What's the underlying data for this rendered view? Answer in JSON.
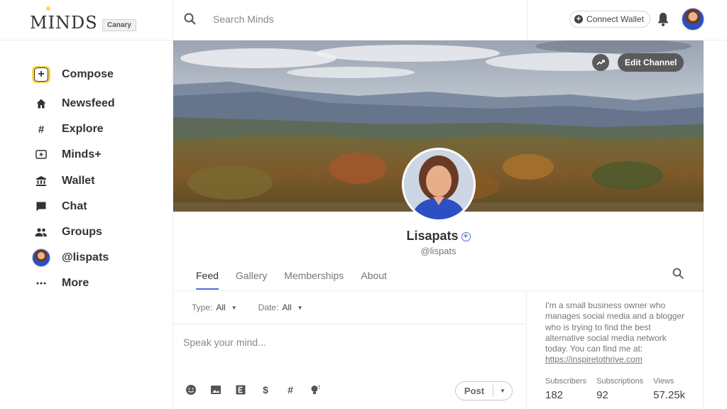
{
  "brand": {
    "logo_text": "MINDS",
    "badge": "Canary"
  },
  "nav": {
    "items": [
      {
        "label": "Compose",
        "icon": "compose-icon"
      },
      {
        "label": "Newsfeed",
        "icon": "home-icon"
      },
      {
        "label": "Explore",
        "icon": "hashtag-icon"
      },
      {
        "label": "Minds+",
        "icon": "minds-plus-icon"
      },
      {
        "label": "Wallet",
        "icon": "bank-icon"
      },
      {
        "label": "Chat",
        "icon": "chat-icon"
      },
      {
        "label": "Groups",
        "icon": "groups-icon"
      },
      {
        "label": "@lispats",
        "icon": "avatar"
      },
      {
        "label": "More",
        "icon": "more-icon"
      }
    ]
  },
  "topbar": {
    "search_placeholder": "Search Minds",
    "connect_wallet": "Connect Wallet"
  },
  "banner": {
    "edit_label": "Edit Channel"
  },
  "profile": {
    "display_name": "Lisapats",
    "handle": "@lispats"
  },
  "tabs": [
    {
      "label": "Feed",
      "active": true
    },
    {
      "label": "Gallery",
      "active": false
    },
    {
      "label": "Memberships",
      "active": false
    },
    {
      "label": "About",
      "active": false
    }
  ],
  "filters": {
    "type_label": "Type:",
    "type_value": "All",
    "date_label": "Date:",
    "date_value": "All"
  },
  "composer": {
    "placeholder": "Speak your mind...",
    "post_label": "Post",
    "tools": [
      "emoji-icon",
      "image-icon",
      "blog-icon",
      "dollar-icon",
      "hashtag-icon",
      "idea-icon"
    ]
  },
  "about": {
    "bio": "I'm a small business owner who manages social media and a blogger who is trying to find the best alternative social media network today. You can find me at:",
    "link": "https://inspiretothrive.com"
  },
  "stats": [
    {
      "label": "Subscribers",
      "value": "182"
    },
    {
      "label": "Subscriptions",
      "value": "92"
    },
    {
      "label": "Views",
      "value": "57.25k"
    }
  ],
  "colors": {
    "accent": "#4a6fd6",
    "compose_yellow": "#ffd54f"
  }
}
